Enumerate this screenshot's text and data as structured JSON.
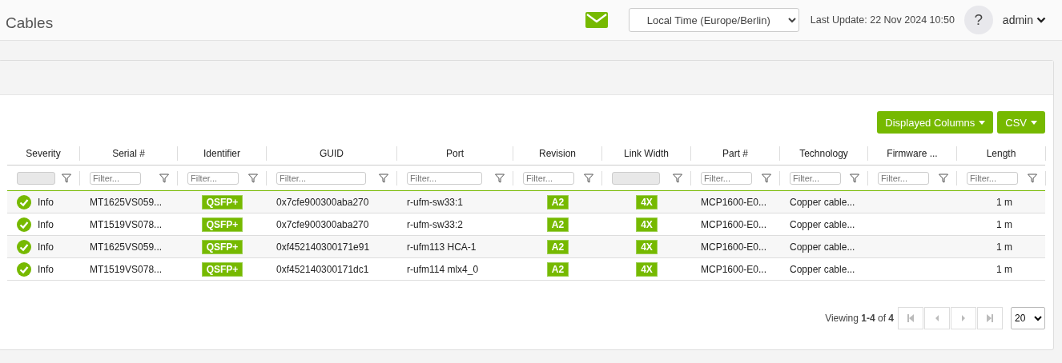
{
  "page_title": "Cables",
  "header": {
    "timezone": "Local Time (Europe/Berlin)",
    "last_update": "Last Update: 22 Nov 2024 10:50",
    "help": "?",
    "user": "admin"
  },
  "toolbar": {
    "buttons": [
      {
        "label": "Displayed Columns"
      },
      {
        "label": "CSV"
      }
    ]
  },
  "table": {
    "columns": [
      {
        "label": "Severity",
        "kind": "status",
        "filter": {
          "kind": "select"
        }
      },
      {
        "label": "Serial #",
        "kind": "text",
        "filter": {
          "kind": "text",
          "placeholder": "Filter..."
        }
      },
      {
        "label": "Identifier",
        "kind": "badge",
        "filter": {
          "kind": "text",
          "placeholder": "Filter..."
        }
      },
      {
        "label": "GUID",
        "kind": "text",
        "filter": {
          "kind": "text",
          "placeholder": "Filter..."
        }
      },
      {
        "label": "Port",
        "kind": "text",
        "filter": {
          "kind": "text",
          "placeholder": "Filter..."
        }
      },
      {
        "label": "Revision",
        "kind": "badge",
        "filter": {
          "kind": "text",
          "placeholder": "Filter..."
        }
      },
      {
        "label": "Link Width",
        "kind": "badge",
        "filter": {
          "kind": "select"
        }
      },
      {
        "label": "Part #",
        "kind": "text",
        "filter": {
          "kind": "text",
          "placeholder": "Filter..."
        }
      },
      {
        "label": "Technology",
        "kind": "text",
        "filter": {
          "kind": "text",
          "placeholder": "Filter..."
        }
      },
      {
        "label": "Firmware ...",
        "kind": "text",
        "filter": {
          "kind": "text",
          "placeholder": "Filter..."
        }
      },
      {
        "label": "Length",
        "kind": "number",
        "filter": {
          "kind": "text",
          "placeholder": "Filter..."
        }
      }
    ],
    "rows": [
      {
        "cells": [
          "Info",
          "MT1625VS059...",
          "QSFP+",
          "0x7cfe900300aba270",
          "r-ufm-sw33:1",
          "A2",
          "4X",
          "MCP1600-E0...",
          "Copper cable...",
          "",
          "1 m"
        ]
      },
      {
        "cells": [
          "Info",
          "MT1519VS078...",
          "QSFP+",
          "0x7cfe900300aba270",
          "r-ufm-sw33:2",
          "A2",
          "4X",
          "MCP1600-E0...",
          "Copper cable...",
          "",
          "1 m"
        ]
      },
      {
        "cells": [
          "Info",
          "MT1625VS059...",
          "QSFP+",
          "0xf452140300171e91",
          "r-ufm113 HCA-1",
          "A2",
          "4X",
          "MCP1600-E0...",
          "Copper cable...",
          "",
          "1 m"
        ]
      },
      {
        "cells": [
          "Info",
          "MT1519VS078...",
          "QSFP+",
          "0xf452140300171dc1",
          "r-ufm114 mlx4_0",
          "A2",
          "4X",
          "MCP1600-E0...",
          "Copper cable...",
          "",
          "1 m"
        ]
      }
    ]
  },
  "pager": {
    "viewing": "Viewing **1-4** of **4**",
    "page_size": "20",
    "first_disabled": true,
    "prev_disabled": true,
    "next_disabled": true,
    "last_disabled": true
  }
}
